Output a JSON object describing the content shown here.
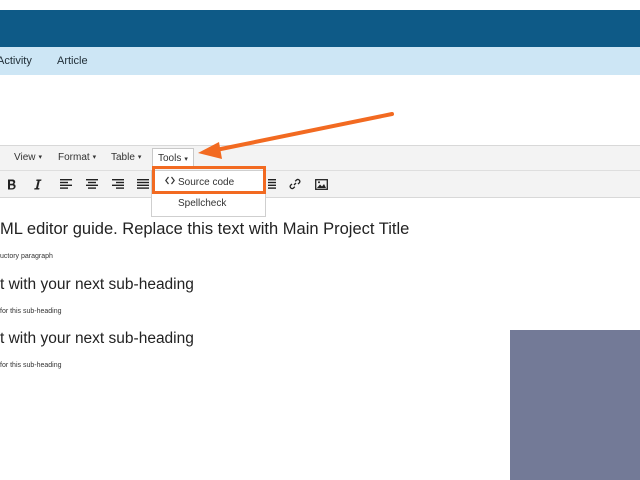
{
  "nav": {
    "items": [
      "Activity",
      "Article"
    ]
  },
  "menubar": {
    "items": [
      "View",
      "Format",
      "Table",
      "Tools"
    ],
    "caret": "▾"
  },
  "toolbar": {
    "buttons": [
      "bold-icon",
      "italic-icon",
      "align-left-icon",
      "align-center-icon",
      "align-right-icon",
      "align-justify-icon",
      "link-icon",
      "image-icon"
    ]
  },
  "dropdown": {
    "items": [
      {
        "icon": "code-icon",
        "label": "Source code"
      },
      {
        "label": "Spellcheck"
      }
    ]
  },
  "content": {
    "title": "ML editor guide. Replace this text with Main Project Title",
    "intro": "uctory paragraph",
    "sections": [
      {
        "heading": "t with your next sub-heading",
        "body": "for this sub-heading"
      },
      {
        "heading": "t with your next sub-heading",
        "body": "for this sub-heading"
      }
    ]
  },
  "colors": {
    "header": "#0e5a87",
    "nav": "#cde6f5",
    "highlight": "#f26a21",
    "panel": "#737a97"
  }
}
